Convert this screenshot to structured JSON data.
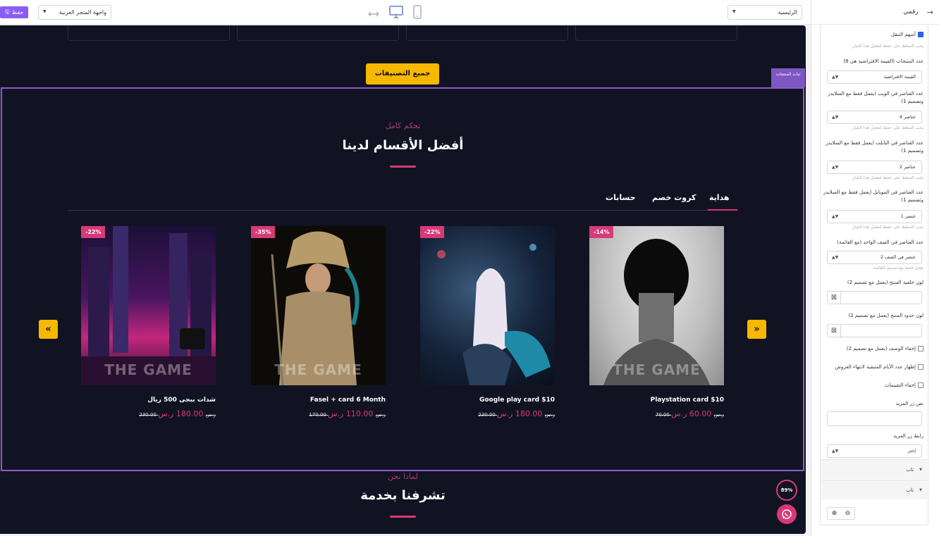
{
  "topbar": {
    "save_label": "حفظ",
    "store_select": "واجهة المتجر العربية",
    "page_select": "الرئيسية"
  },
  "sidebar": {
    "title": "رقمي",
    "nav_arrows_label": "أسهم التنقل",
    "nav_arrows_checked": true,
    "hint_enable": "يجب الضغط على حفظ لتفعيل هذا الخيار",
    "products_count_label": "عدد المنتجات (القيمة الافتراضية هي 8)",
    "products_count_value": "القيمة الافتراضية",
    "web_items_label": "عدد العناصر في الويب (يعمل فقط مع السلايدر وتصميم 1)",
    "web_items_value": "4 عناصر",
    "tablet_items_label": "عدد العناصر في التابلت (يعمل فقط مع السلايدر وتصميم 1)",
    "tablet_items_value": "2 عناصر",
    "mobile_items_label": "عدد العناصر في الموبايل (يعمل فقط مع السلايدر وتصميم 1)",
    "mobile_items_value": "1 عنصر",
    "row_items_label": "عدد العناصر في الصف الواحد (مع القائمة)",
    "row_items_value": "2 عنصر في الصف",
    "row_items_hint": "يعمل فقط مع تصميم القائمة",
    "bg_color_label": "لون خلفية المنتج (يعمل مع تصميم 2)",
    "border_color_label": "لون حدود المنتج (يعمل مع تصميم 2)",
    "hide_desc_label": "إخفاء الوصف (يعمل مع تصميم 2)",
    "show_days_label": "إظهار عدد الأيام المتبقية لانتهاء العروض",
    "hide_ratings_label": "إخفاء التقييمات",
    "more_text_label": "نص زر المزيد",
    "more_link_label": "رابط زر المزيد",
    "more_link_value": "إختر",
    "accordion": [
      "تاب",
      "تاب"
    ]
  },
  "canvas": {
    "all_categories_button": "جميع التصنيفات",
    "side_tag": "ثبات المنتجات",
    "section_subtitle": "تحكم كامل",
    "section_title": "أفضل الأقسام لدينا",
    "tabs": [
      "هداية",
      "كروت خصم",
      "حسابات"
    ],
    "products": [
      {
        "name": "Playstation card $10",
        "price": "60.00 ر.س",
        "old_price": "70.00 ر.س",
        "discount": "-14%",
        "watermark": "THE GAME"
      },
      {
        "name": "Google play card $10",
        "price": "180.00 ر.س",
        "old_price": "230.00 ر.س",
        "discount": "-22%",
        "watermark": "THE GAME"
      },
      {
        "name": "Fasel + card 6 Month",
        "price": "110.00 ر.س",
        "old_price": "170.00 ر.س",
        "discount": "-35%",
        "watermark": "THE GAME"
      },
      {
        "name": "شدات ببجى 500 ريال",
        "price": "180.00 ر.س",
        "old_price": "230.00 ر.س",
        "discount": "-22%",
        "watermark": "THE GAME"
      }
    ],
    "next_subtitle": "لماذا نحن",
    "next_title": "تشرفنا بخدمة",
    "progress_value": "89%",
    "arrow_left": "«",
    "arrow_right": "»"
  },
  "colors": {
    "accent_pink": "#d83a78",
    "accent_yellow": "#f6b800",
    "canvas_bg": "#111322",
    "frame_purple": "#8e5cc9"
  }
}
